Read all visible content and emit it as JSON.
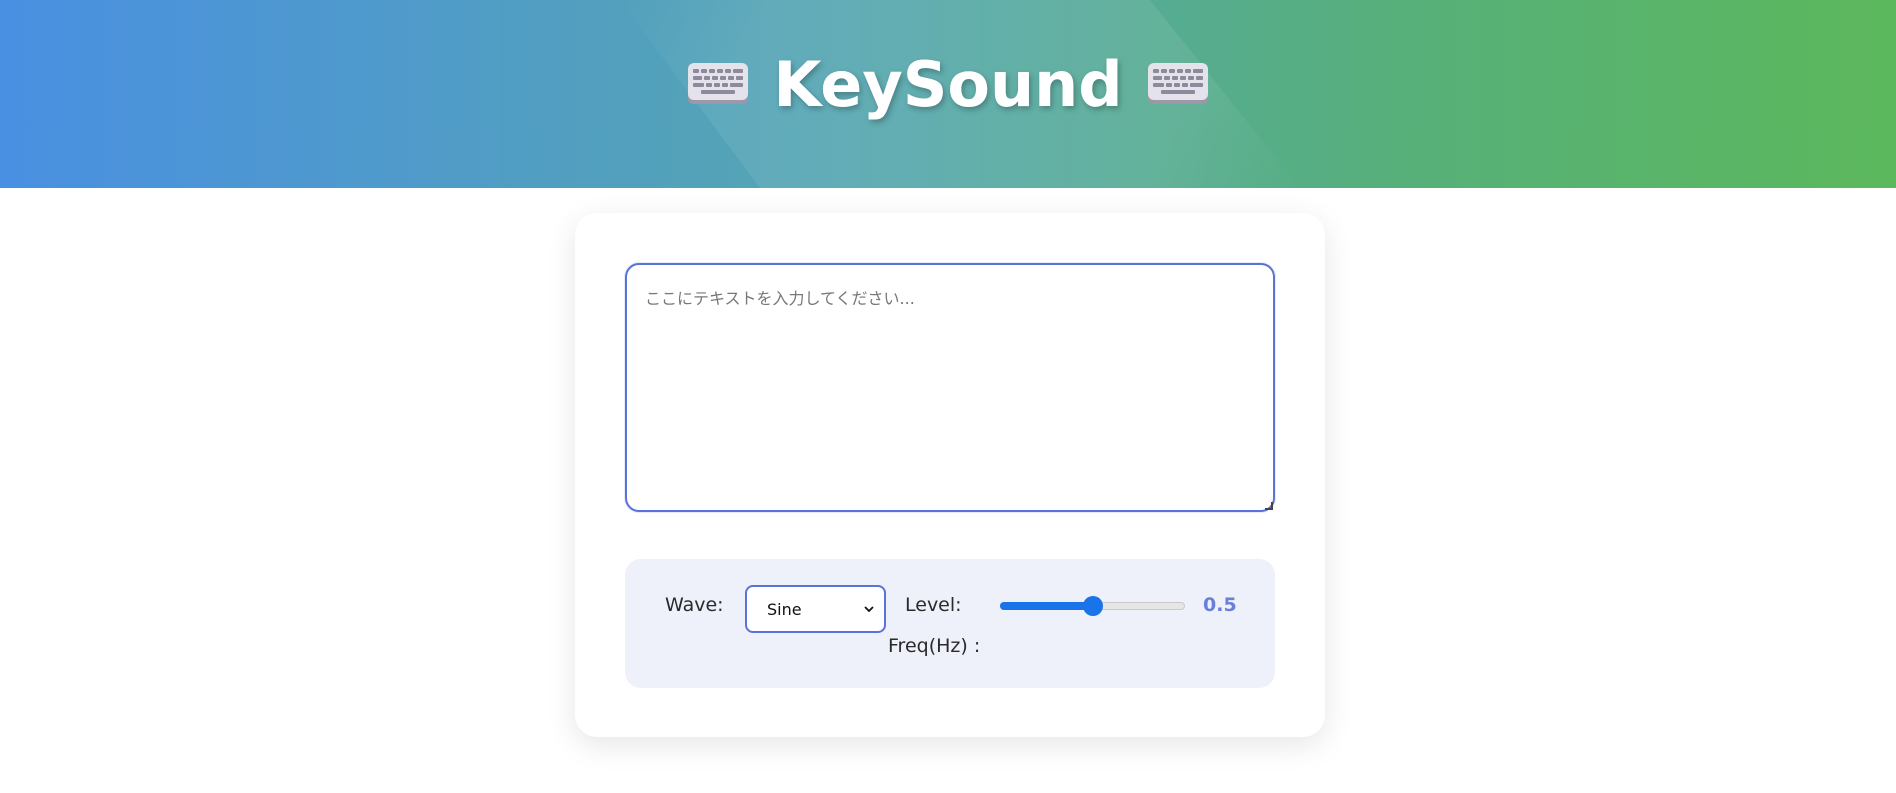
{
  "header": {
    "title": "KeySound",
    "left_icon": "keyboard-icon",
    "right_icon": "keyboard-icon",
    "gradient_start": "#4a90e2",
    "gradient_end": "#5cb85c"
  },
  "editor": {
    "placeholder": "ここにテキストを入力してください...",
    "value": "",
    "accent": "#5a73d8"
  },
  "controls": {
    "wave_label": "Wave:",
    "wave_selected": "Sine",
    "level_label": "Level:",
    "level_value": "0.5",
    "level_fraction": 0.5,
    "freq_label": "Freq(Hz) :",
    "slider_color": "#1a73e8"
  }
}
